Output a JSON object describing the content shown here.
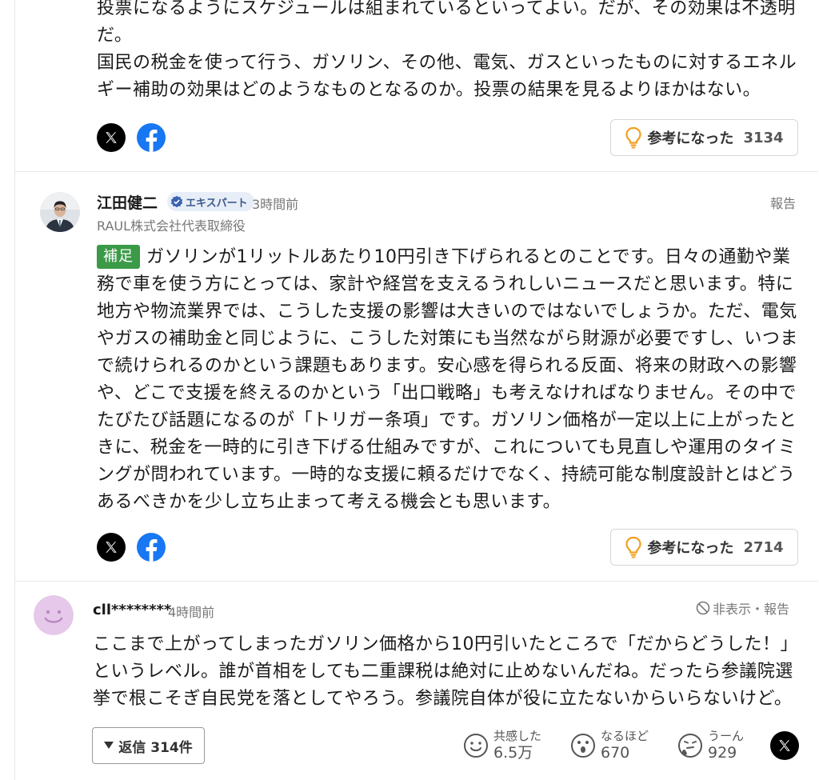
{
  "comment1": {
    "text": "投票になるようにスケジュールは組まれているといってよい。だが、その効果は不透明だ。\n国民の税金を使って行う、ガソリン、その他、電気、ガスといったものに対するエネルギー補助の効果はどのようなものとなるのか。投票の結果を見るよりほかはない。",
    "helpful_label": "参考になった",
    "helpful_count": "3134"
  },
  "comment2": {
    "author": "江田健二",
    "badge": "エキスパート",
    "time": "3時間前",
    "title": "RAUL株式会社代表取締役",
    "report": "報告",
    "tag": "補足",
    "text": "ガソリンが1リットルあたり10円引き下げられるとのことです。日々の通勤や業務で車を使う方にとっては、家計や経営を支えるうれしいニュースだと思います。特に地方や物流業界では、こうした支援の影響は大きいのではないでしょうか。ただ、電気やガスの補助金と同じように、こうした対策にも当然ながら財源が必要ですし、いつまで続けられるのかという課題もあります。安心感を得られる反面、将来の財政への影響や、どこで支援を終えるのかという「出口戦略」も考えなければなりません。その中でたびたび話題になるのが「トリガー条項」です。ガソリン価格が一定以上に上がったときに、税金を一時的に引き下げる仕組みですが、これについても見直しや運用のタイミングが問われています。一時的な支援に頼るだけでなく、持続可能な制度設計とはどうあるべきかを少し立ち止まって考える機会とも思います。",
    "helpful_label": "参考になった",
    "helpful_count": "2714"
  },
  "comment3": {
    "author": "cll********",
    "time": "4時間前",
    "hide_report": "非表示・報告",
    "text": "ここまで上がってしまったガソリン価格から10円引いたところで「だからどうした！」というレベル。誰が首相をしても二重課税は絶対に止めないんだね。だったら参議院選挙で根こそぎ自民党を落としてやろう。参議院自体が役に立たないからいらないけど。",
    "reply_label": "返信",
    "reply_count": "314件",
    "reactions": [
      {
        "label": "共感した",
        "value": "6.5万",
        "icon": "smile-face-icon"
      },
      {
        "label": "なるほど",
        "value": "670",
        "icon": "surprised-face-icon"
      },
      {
        "label": "うーん",
        "value": "929",
        "icon": "thinking-face-icon"
      }
    ]
  },
  "colors": {
    "tag_green": "#3b9a48",
    "facebook_blue": "#1877f2",
    "bulb_orange": "#f0a020"
  }
}
